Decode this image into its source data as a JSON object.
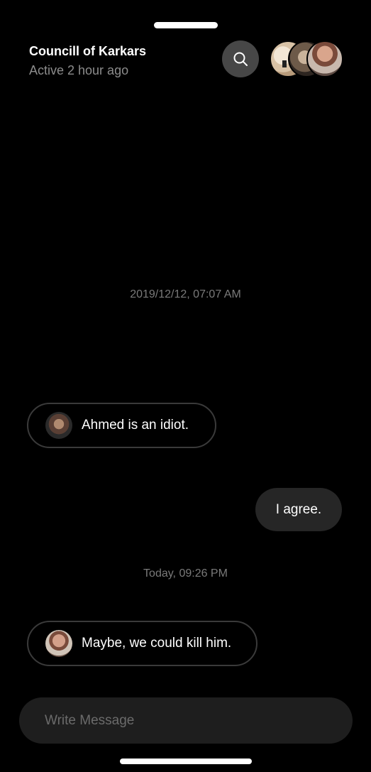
{
  "header": {
    "title": "Councill of Karkars",
    "status": "Active 2 hour ago",
    "search_icon": "search-icon"
  },
  "messages": [
    {
      "timestamp": "2019/12/12, 07:07 AM"
    },
    {
      "direction": "incoming",
      "text": "Ahmed is an idiot."
    },
    {
      "direction": "outgoing",
      "text": "I agree."
    },
    {
      "timestamp": "Today, 09:26 PM"
    },
    {
      "direction": "incoming",
      "text": "Maybe, we could kill him."
    }
  ],
  "composer": {
    "placeholder": "Write Message"
  },
  "colors": {
    "background": "#000000",
    "bubble_outgoing": "#262626",
    "bubble_incoming_border": "#3a3a3a",
    "muted_text": "#8c8c8c",
    "search_button": "#474747",
    "composer_bg": "#1e1e1e"
  }
}
